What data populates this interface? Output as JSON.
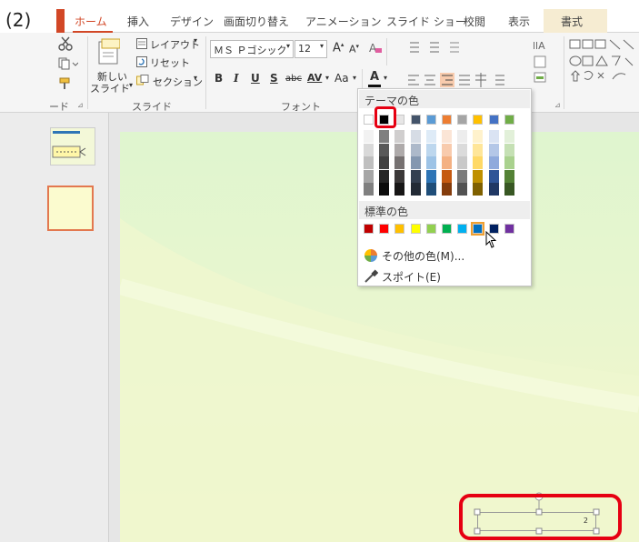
{
  "step_label": "(2)",
  "tabs": {
    "home": "ホーム",
    "insert": "挿入",
    "design": "デザイン",
    "transitions": "画面切り替え",
    "animations": "アニメーション",
    "slideshow": "スライド ショー",
    "review": "校閲",
    "view": "表示",
    "format": "書式"
  },
  "ribbon": {
    "clipboard_label": "ード",
    "slides": {
      "new_slide_line1": "新しい",
      "new_slide_line2": "スライド",
      "layout": "レイアウト",
      "reset": "リセット",
      "section": "セクション",
      "label": "スライド"
    },
    "font": {
      "name": "ＭＳ Ｐゴシック",
      "size": "12",
      "bold": "B",
      "italic": "I",
      "underline": "U",
      "shadow": "S",
      "strike": "abc",
      "spacing": "AV",
      "case": "Aa",
      "color": "A",
      "label": "フォント"
    }
  },
  "color_menu": {
    "theme_header": "テーマの色",
    "standard_header": "標準の色",
    "more_colors": "その他の色(M)...",
    "eyedropper": "スポイト(E)",
    "theme_top": [
      "#ffffff",
      "#000000",
      "#e7e6e6",
      "#44546a",
      "#5b9bd5",
      "#ed7d31",
      "#a5a5a5",
      "#ffc000",
      "#4472c4",
      "#70ad47"
    ],
    "theme_shades": [
      [
        "#f2f2f2",
        "#d9d9d9",
        "#bfbfbf",
        "#a6a6a6",
        "#808080"
      ],
      [
        "#808080",
        "#595959",
        "#404040",
        "#262626",
        "#0d0d0d"
      ],
      [
        "#d0cece",
        "#aeaaaa",
        "#767171",
        "#3b3838",
        "#171616"
      ],
      [
        "#d6dce5",
        "#adb9ca",
        "#8497b0",
        "#333f50",
        "#222a35"
      ],
      [
        "#deebf7",
        "#bdd7ee",
        "#9dc3e6",
        "#2e75b6",
        "#1f4e79"
      ],
      [
        "#fbe5d6",
        "#f8cbad",
        "#f4b183",
        "#c55a11",
        "#843c0c"
      ],
      [
        "#ededed",
        "#dbdbdb",
        "#c9c9c9",
        "#7b7b7b",
        "#525252"
      ],
      [
        "#fff2cc",
        "#ffe699",
        "#ffd966",
        "#bf9000",
        "#7f6000"
      ],
      [
        "#dae3f3",
        "#b4c7e7",
        "#8faadc",
        "#2f5597",
        "#203864"
      ],
      [
        "#e2f0d9",
        "#c5e0b4",
        "#a9d18e",
        "#548235",
        "#385723"
      ]
    ],
    "standard": [
      "#c00000",
      "#ff0000",
      "#ffc000",
      "#ffff00",
      "#92d050",
      "#00b050",
      "#00b0f0",
      "#0070c0",
      "#002060",
      "#7030a0"
    ]
  },
  "slide": {
    "textbox_number": "2"
  }
}
